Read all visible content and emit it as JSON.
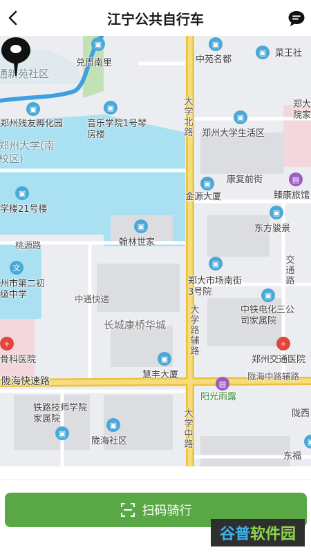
{
  "header": {
    "title": "江宁公共自行车",
    "back_icon": "chevron-left-icon",
    "message_icon": "chat-bubble-icon"
  },
  "map": {
    "labels": {
      "tongxinyuan": "通新苑社区",
      "duiyuannanli": "兑周南里",
      "zhongyuanmingdu": "中苑名都",
      "caiwangshe": "菜王社",
      "zhengzhou_canyou": "郑州残友孵化园",
      "yinyuexueyuan": "音乐学院1号琴房楼",
      "daxue_north_road": "大学北路",
      "zzu_living": "郑州大学生活区",
      "zheng_jia": "郑大院家",
      "zzu_south": "郑州大学(南校区)",
      "kangfu_qianjie": "康复前街",
      "jinyuan_dasha": "金源大厦",
      "zhenlv": "臻康旅馆",
      "xuexiaolou21": "学楼21号楼",
      "dongfangjunjing": "东方骏景",
      "taoyuanlu": "桃源路",
      "hanlinshijia": "翰林世家",
      "jiaotonglu": "交通路",
      "zhengzhoudier": "州市第二初级中学",
      "zhengda_market": "郑大市场南街3号院",
      "zhongtong_kuaidi": "中通快递",
      "zhongtie": "中铁电化三公司家属院",
      "changcheng": "长城康桥华城",
      "daxue_fudao": "大学路辅路",
      "guke": "骨科医院",
      "zhengzhou_jiaotong_hospital": "郑州交通医院",
      "huifeng": "慧丰大厦",
      "longhai_expressway": "陇海快速路",
      "longhai_zhong_fudao": "陇海中路辅路",
      "yangguangyulu": "阳光雨露",
      "tielu": "铁路技师学院家属院",
      "daxue_zhonglu": "大学中路",
      "longhai_community": "陇海社区",
      "longxi": "陇西",
      "dongfu": "东福"
    }
  },
  "bottom": {
    "scan_button_label": "扫码骑行",
    "scan_icon": "scan-frame-icon"
  },
  "watermark": {
    "part1": "谷普",
    "part2": "软件园"
  },
  "colors": {
    "accent": "#5aa845",
    "road_yellow": "#f3cd4c",
    "campus_blue": "#a9e0f2",
    "poi_blue": "#4aa8d8"
  }
}
